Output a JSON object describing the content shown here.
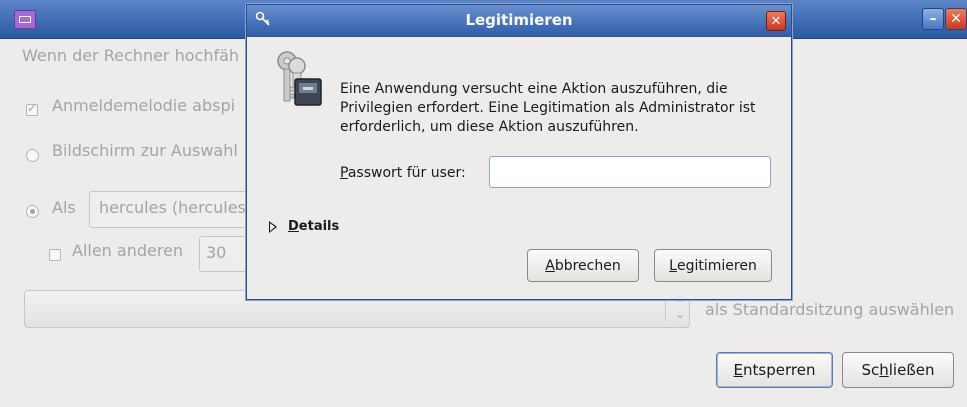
{
  "background": {
    "intro_text": "Wenn der Rechner hochfäh",
    "melody_label": "Anmeldemelodie abspi",
    "melody_checked": true,
    "chooser_label": "Bildschirm zur Auswahl",
    "as_label": "Als",
    "user_value": "hercules (hercules",
    "others_label": "Allen anderen",
    "seconds_value": "30",
    "session_suffix": "als Standardsitzung auswählen",
    "unlock_button": {
      "mnemonic": "E",
      "rest": "ntsperren"
    },
    "close_button": {
      "pre": "Sc",
      "mnemonic": "h",
      "rest": "ließen"
    }
  },
  "dialog": {
    "title": "Legitimieren",
    "message": "Eine Anwendung versucht eine Aktion auszuführen, die Privilegien erfordert. Eine Legitimation als Administrator ist erforderlich, um diese Aktion auszuführen.",
    "password_label": {
      "mnemonic": "P",
      "rest": "asswort für user:"
    },
    "password_value": "",
    "details": {
      "mnemonic": "D",
      "rest": "etails"
    },
    "cancel_button": {
      "mnemonic": "A",
      "rest": "bbrechen"
    },
    "auth_button": {
      "mnemonic": "L",
      "rest": "egitimieren"
    }
  },
  "icons": {
    "app": "login-settings-icon",
    "dialog_small": "keys-icon",
    "dialog_large": "keys-lock-icon"
  },
  "colors": {
    "titlebar": "#2b5aa5",
    "close_button": "#c93a1c",
    "dialog_bg": "#edeceb"
  }
}
